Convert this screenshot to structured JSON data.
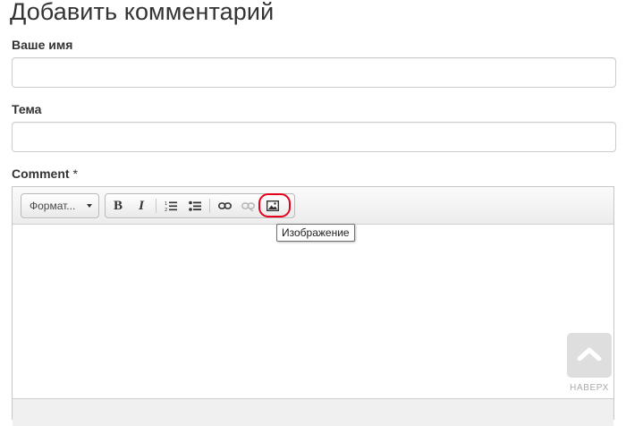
{
  "page": {
    "title": "Добавить комментарий"
  },
  "form": {
    "name_label": "Ваше имя",
    "name_value": "",
    "subject_label": "Тема",
    "subject_value": "",
    "comment_label": "Comment",
    "required_mark": "*"
  },
  "editor": {
    "format_select_value": "Формат...",
    "toolbar": {
      "bold": "B",
      "italic": "I"
    },
    "tooltip": "Изображение",
    "highlight_color": "#e8001a"
  },
  "back_to_top": {
    "label": "НАВЕРХ"
  }
}
